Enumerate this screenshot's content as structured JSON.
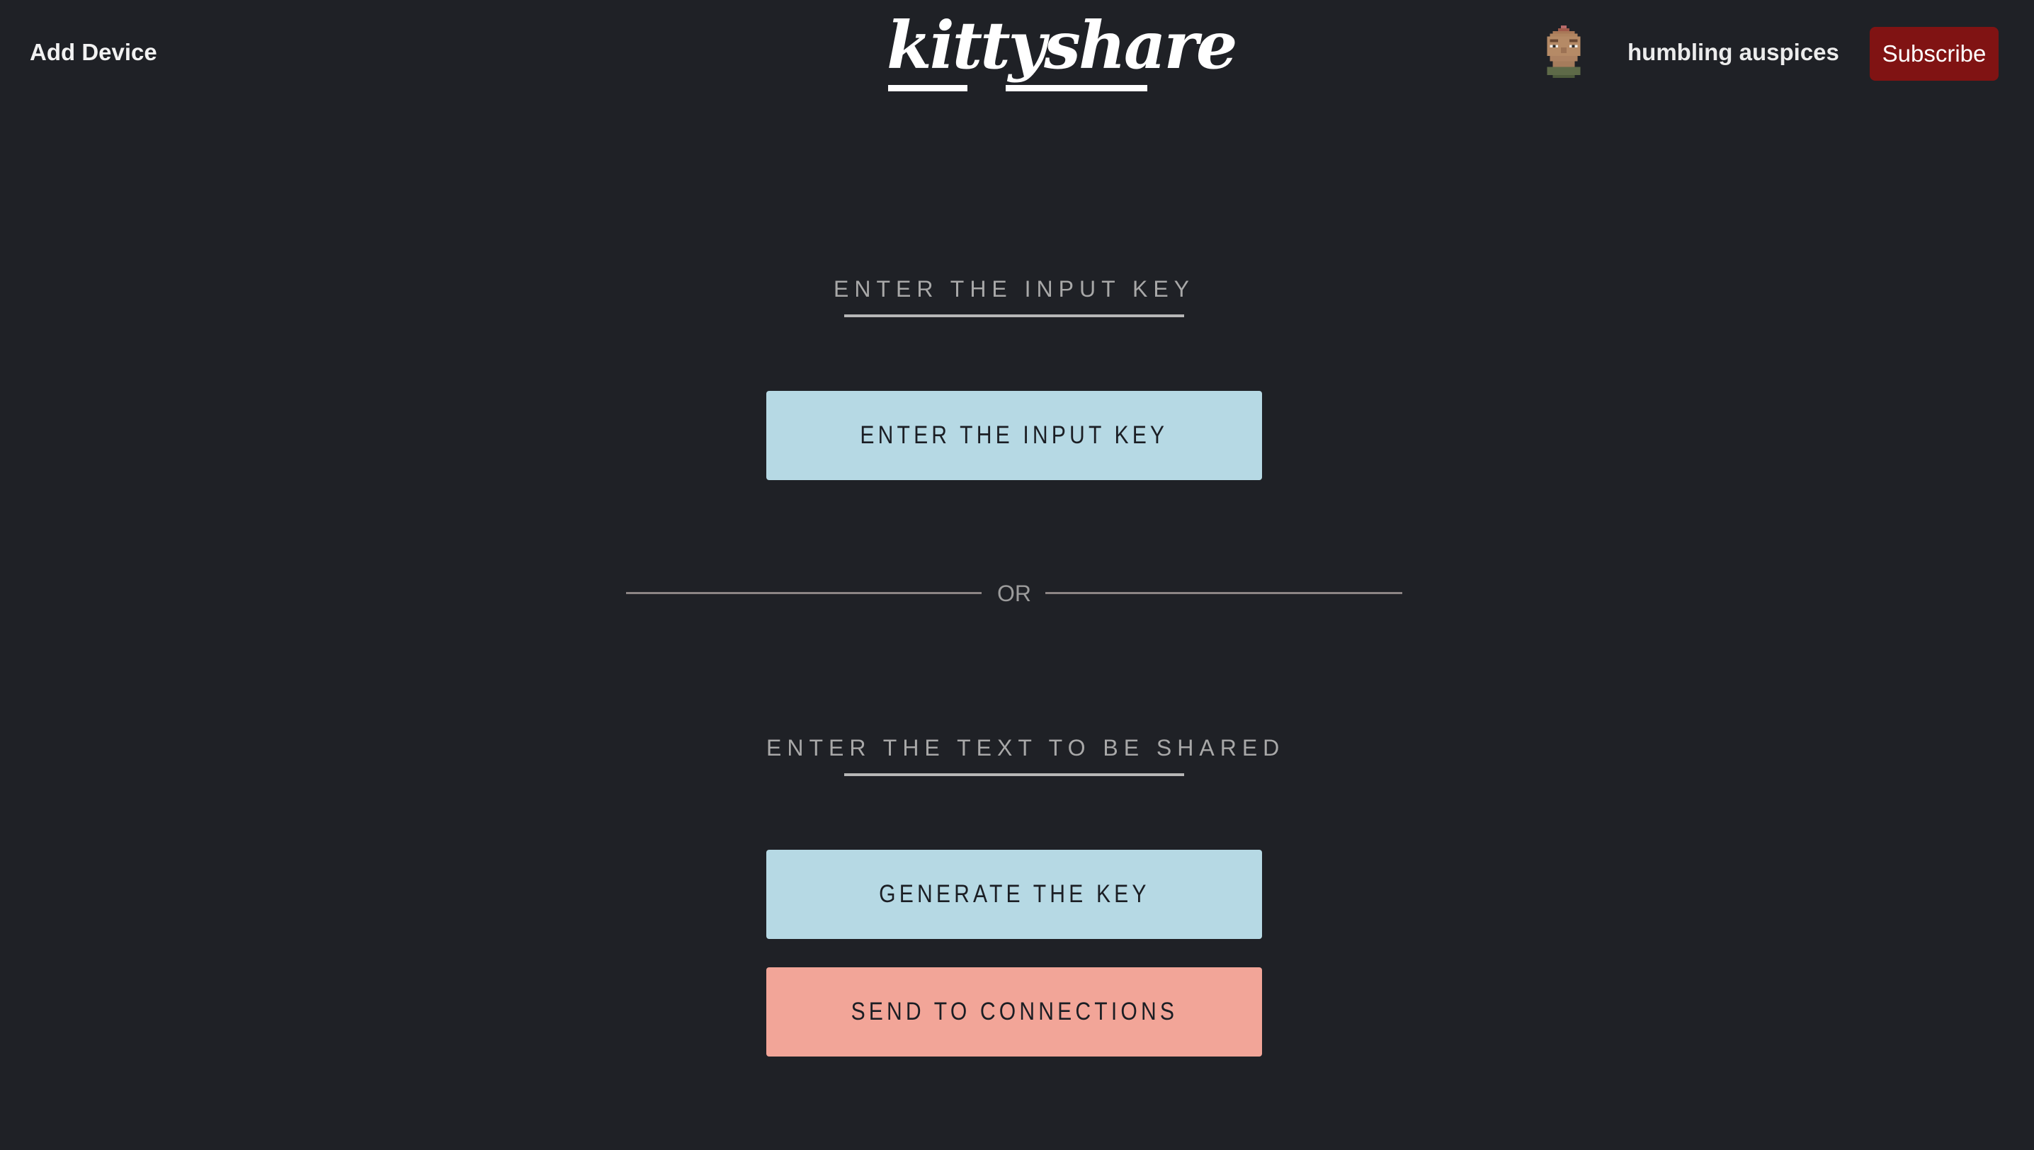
{
  "header": {
    "add_device_label": "Add Device",
    "logo_text": "kittyshare",
    "username": "humbling auspices",
    "subscribe_label": "Subscribe"
  },
  "main": {
    "input_key_label": "ENTER THE INPUT KEY",
    "input_key_button": "ENTER THE INPUT KEY",
    "divider_text": "OR",
    "share_text_label": "ENTER THE TEXT TO BE SHARED",
    "generate_key_button": "GENERATE THE KEY",
    "send_connections_button": "SEND TO CONNECTIONS"
  },
  "colors": {
    "background": "#1f2126",
    "button_blue": "#b6d9e4",
    "button_salmon": "#f2a598",
    "subscribe_red": "#801313"
  },
  "icons": {
    "avatar": "pixel-art-avatar"
  }
}
